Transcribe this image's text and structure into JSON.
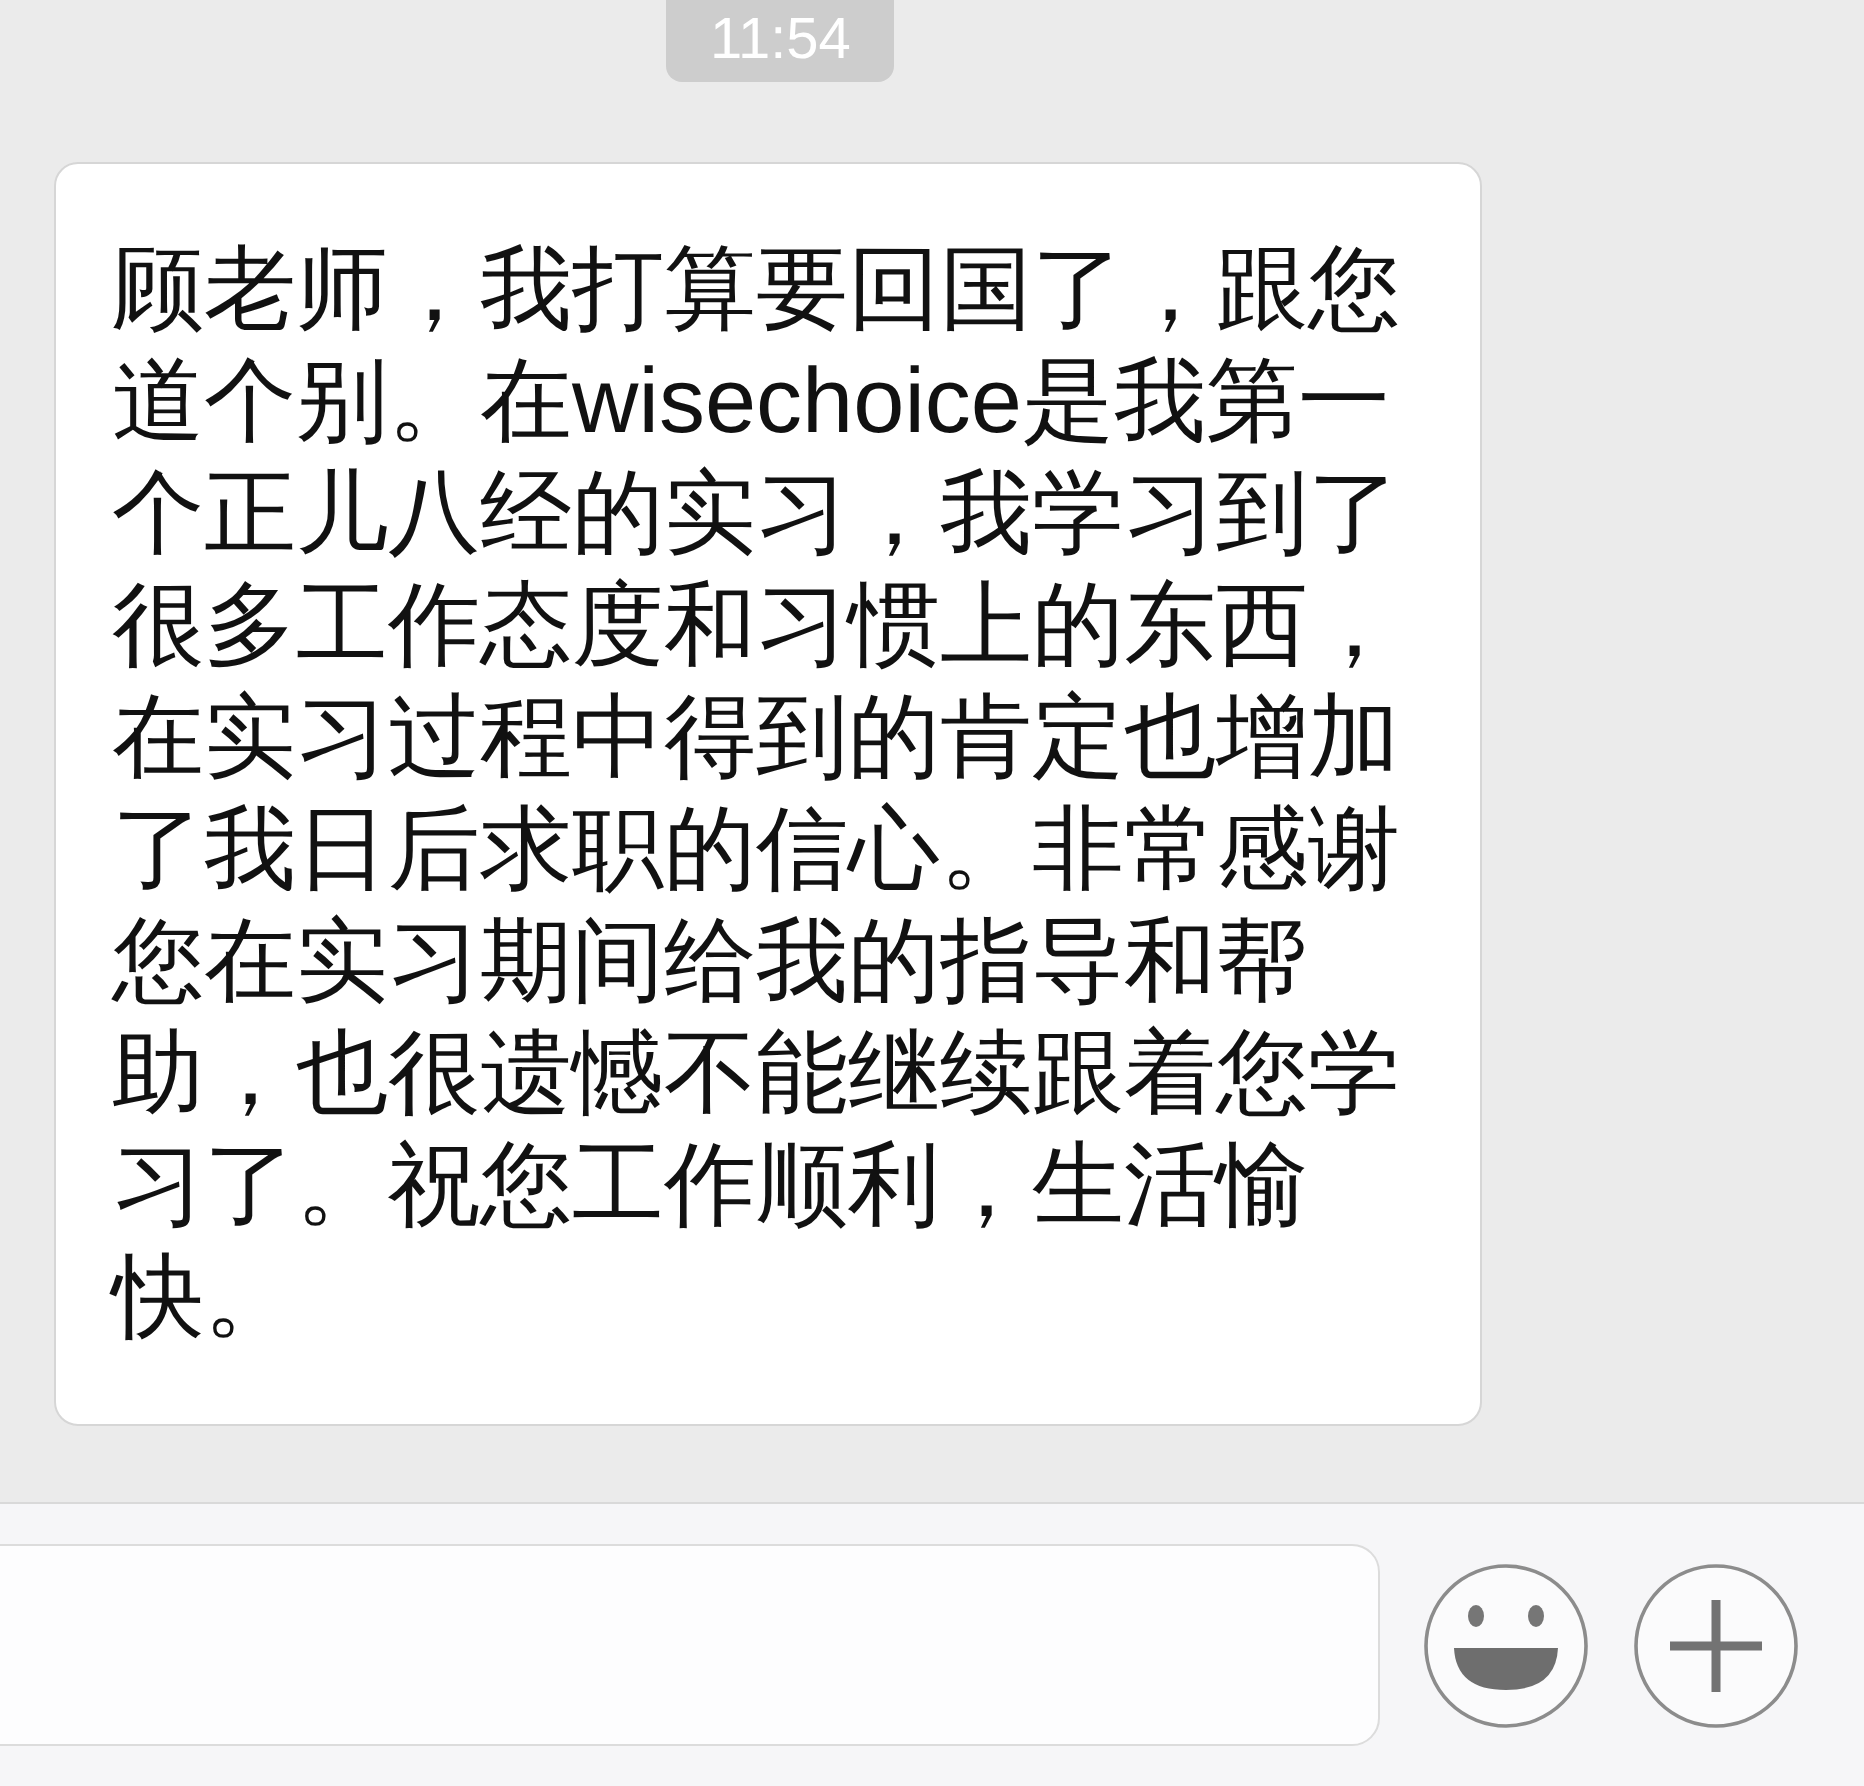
{
  "time_badge": {
    "text": "11:54"
  },
  "message": {
    "text": "顾老师，我打算要回国了，跟您道个别。在wisechoice是我第一个正儿八经的实习，我学习到了很多工作态度和习惯上的东西，在实习过程中得到的肯定也增加了我日后求职的信心。非常感谢您在实习期间给我的指导和帮助，也很遗憾不能继续跟着您学习了。祝您工作顺利，生活愉快。"
  },
  "input_bar": {
    "buttons": [
      {
        "kind": "emoji"
      },
      {
        "kind": "more"
      }
    ]
  }
}
